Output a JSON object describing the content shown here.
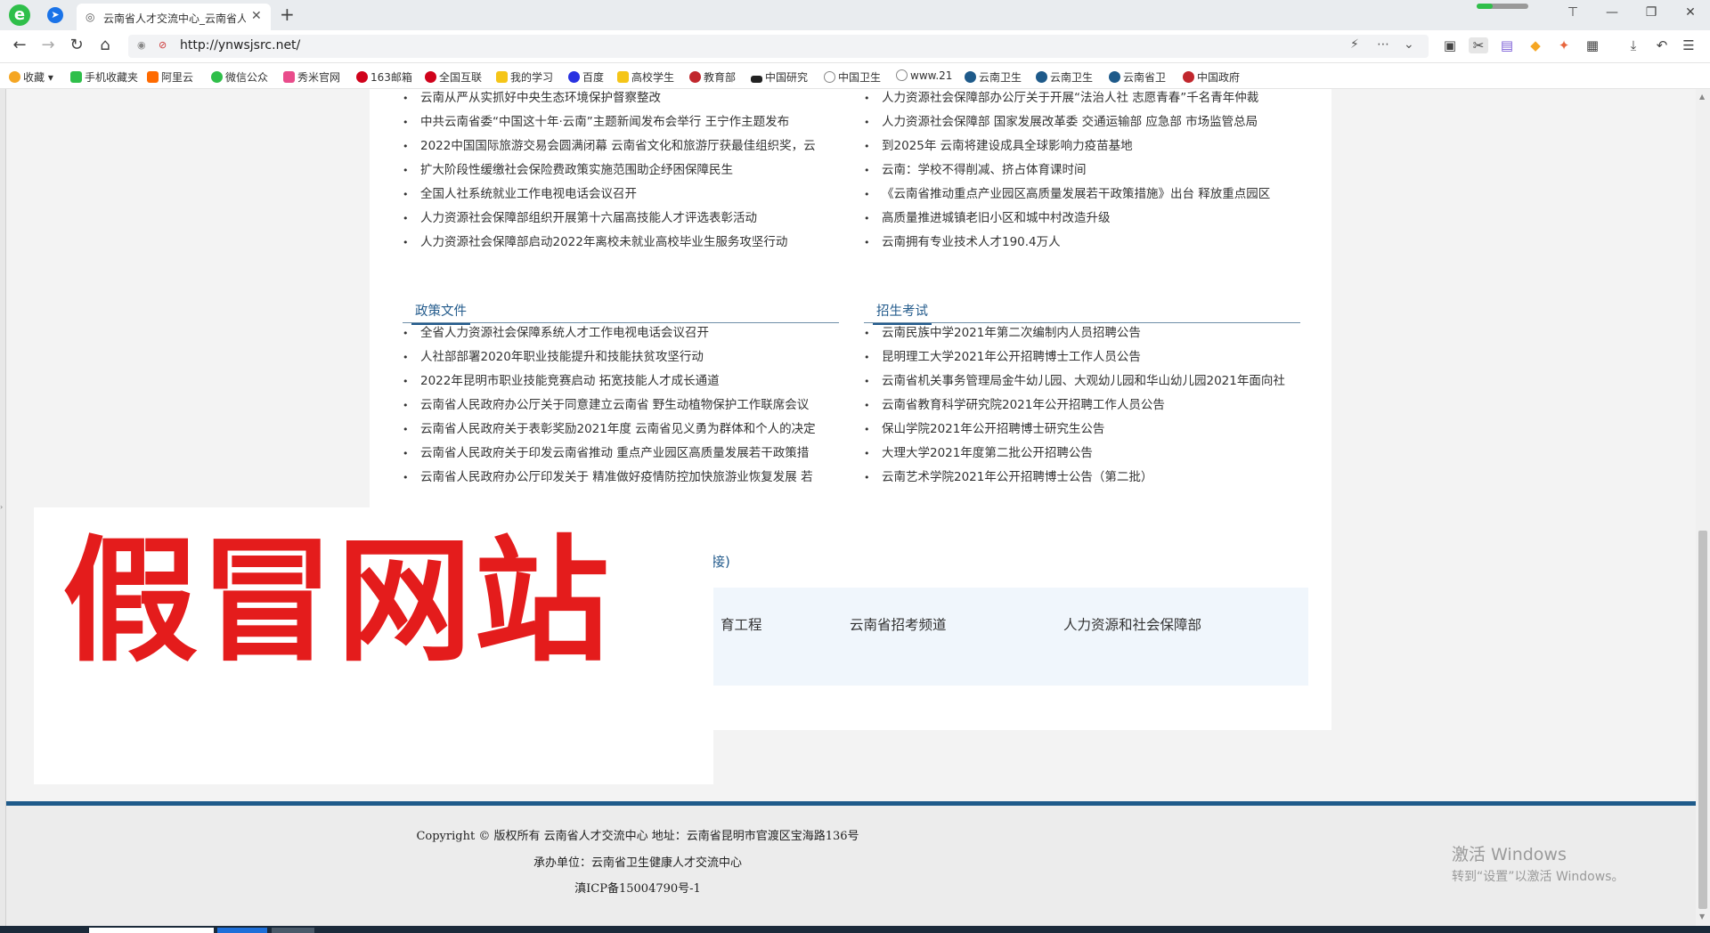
{
  "browser": {
    "tab_title": "云南省人才交流中心_云南省人",
    "url": "http://ynwsjsrc.net/",
    "window_controls": [
      "⊤",
      "—",
      "❐",
      "✕"
    ]
  },
  "bookmarks": [
    {
      "label": "收藏",
      "color": "#f5a623"
    },
    {
      "label": "手机收藏夹",
      "color": "#2fbf4a"
    },
    {
      "label": "阿里云",
      "color": "#ff6a00"
    },
    {
      "label": "微信公众",
      "color": "#2fbf4a"
    },
    {
      "label": "秀米官网",
      "color": "#e94c8b"
    },
    {
      "label": "163邮箱",
      "color": "#d0021b"
    },
    {
      "label": "全国互联",
      "color": "#d0021b"
    },
    {
      "label": "我的学习",
      "color": "#f5c518"
    },
    {
      "label": "百度",
      "color": "#2932e1"
    },
    {
      "label": "高校学生",
      "color": "#f5c518"
    },
    {
      "label": "教育部",
      "color": "#c1272d"
    },
    {
      "label": "中国研究",
      "color": "#222222"
    },
    {
      "label": "中国卫生",
      "color": "#888888"
    },
    {
      "label": "www.21",
      "color": "#888888"
    },
    {
      "label": "云南卫生",
      "color": "#1e5a8a"
    },
    {
      "label": "云南卫生",
      "color": "#1e5a8a"
    },
    {
      "label": "云南省卫",
      "color": "#1e5a8a"
    },
    {
      "label": "中国政府",
      "color": "#c1272d"
    }
  ],
  "news_left": [
    "云南从严从实抓好中央生态环境保护督察整改",
    "中共云南省委“中国这十年·云南”主题新闻发布会举行 王宁作主题发布",
    "2022中国国际旅游交易会圆满闭幕 云南省文化和旅游厅获最佳组织奖，云",
    "扩大阶段性缓缴社会保险费政策实施范围助企纾困保障民生",
    "全国人社系统就业工作电视电话会议召开",
    "人力资源社会保障部组织开展第十六届高技能人才评选表彰活动",
    "人力资源社会保障部启动2022年离校未就业高校毕业生服务攻坚行动"
  ],
  "news_right": [
    "人力资源社会保障部办公厅关于开展“法治人社 志愿青春”千名青年仲裁",
    "人力资源社会保障部 国家发展改革委 交通运输部 应急部 市场监管总局",
    "到2025年 云南将建设成具全球影响力疫苗基地",
    "云南：学校不得削减、挤占体育课时间",
    "《云南省推动重点产业园区高质量发展若干政策措施》出台 释放重点园区",
    "高质量推进城镇老旧小区和城中村改造升级",
    "云南拥有专业技术人才190.4万人"
  ],
  "policy": {
    "title": "政策文件",
    "items": [
      "全省人力资源社会保障系统人才工作电视电话会议召开",
      "人社部部署2020年职业技能提升和技能扶贫攻坚行动",
      "2022年昆明市职业技能竞赛启动 拓宽技能人才成长通道",
      "云南省人民政府办公厅关于同意建立云南省 野生动植物保护工作联席会议",
      "云南省人民政府关于表彰奖励2021年度 云南省见义勇为群体和个人的决定",
      "云南省人民政府关于印发云南省推动 重点产业园区高质量发展若干政策措",
      "云南省人民政府办公厅印发关于 精准做好疫情防控加快旅游业恢复发展 若"
    ]
  },
  "exam": {
    "title": "招生考试",
    "items": [
      "云南民族中学2021年第二次编制内人员招聘公告",
      "昆明理工大学2021年公开招聘博士工作人员公告",
      "云南省机关事务管理局金牛幼儿园、大观幼儿园和华山幼儿园2021年面向社",
      "云南省教育科学研究院2021年公开招聘工作人员公告",
      "保山学院2021年公开招聘博士研究生公告",
      "大理大学2021年度第二批公开招聘公告",
      "云南艺术学院2021年公开招聘博士公告（第二批）"
    ]
  },
  "links": {
    "title_tail": "接)",
    "items": [
      "育工程",
      "云南省招考频道",
      "人力资源和社会保障部"
    ]
  },
  "overlay_text": "假冒网站",
  "footer": {
    "copyright": "Copyright © 版权所有 云南省人才交流中心 地址：云南省昆明市官渡区宝海路136号",
    "organizer": "承办单位：云南省卫生健康人才交流中心",
    "icp": "滇ICP备15004790号-1"
  },
  "activation": {
    "title": "激活 Windows",
    "subtitle": "转到“设置”以激活 Windows。"
  },
  "colors": {
    "accent": "#235b8c",
    "footer_border": "#1e5a8a",
    "overlay_red": "#e41c1c"
  }
}
